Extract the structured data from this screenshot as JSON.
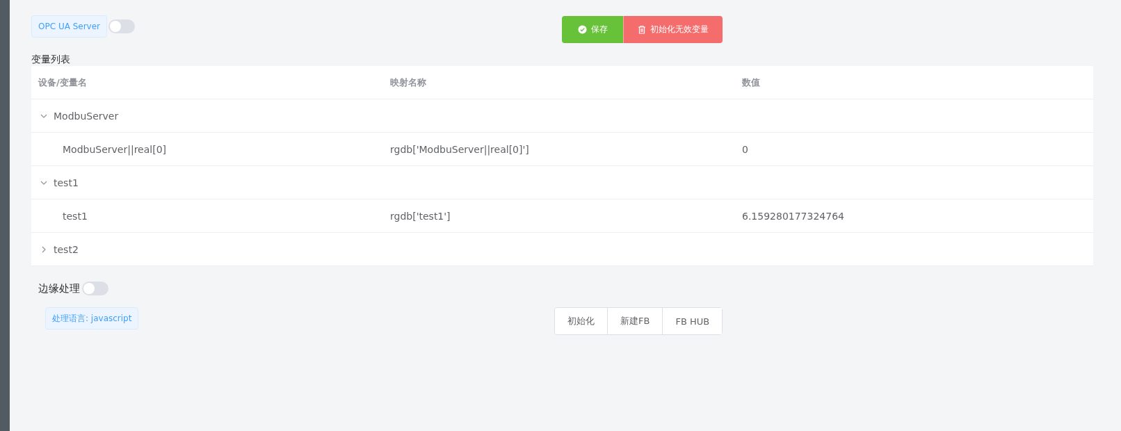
{
  "opc_ua": {
    "tag": "OPC UA Server",
    "on": false
  },
  "actions": [
    {
      "kind": "save",
      "label": "保存"
    },
    {
      "kind": "delete",
      "label": "初始化无效变量"
    }
  ],
  "variable_list": {
    "title": "变量列表",
    "columns": [
      "设备/变量名",
      "映射名称",
      "数值"
    ],
    "rows": [
      {
        "name": "ModbuServer",
        "expanded": true,
        "children": [
          {
            "name": "ModbuServer||real[0]",
            "mapping": "rgdb['ModbuServer||real[0]']",
            "value": "0"
          }
        ]
      },
      {
        "name": "test1",
        "expanded": true,
        "children": [
          {
            "name": "test1",
            "mapping": "rgdb['test1']",
            "value": "6.159280177324764"
          }
        ]
      },
      {
        "name": "test2",
        "expanded": false,
        "children": []
      }
    ]
  },
  "edge": {
    "label": "边缘处理",
    "on": false,
    "tag": "处理语言: javascript"
  },
  "fb_buttons": [
    "初始化",
    "新建FB",
    "FB HUB"
  ]
}
